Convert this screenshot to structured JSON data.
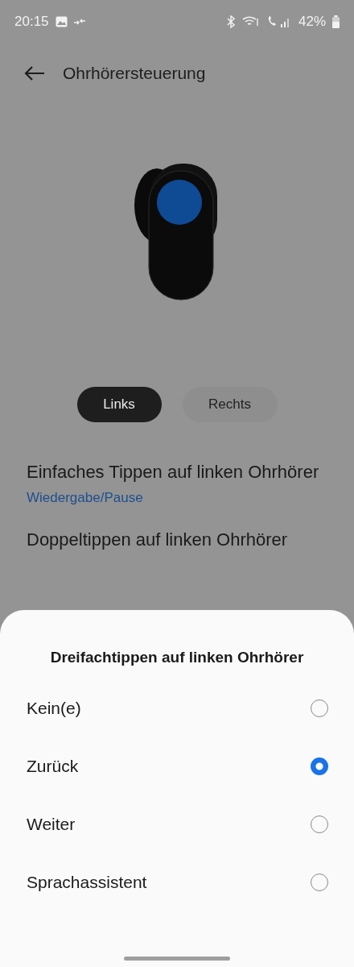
{
  "status_bar": {
    "time": "20:15",
    "battery": "42%"
  },
  "header": {
    "title": "Ohrhörersteuerung"
  },
  "tabs": [
    {
      "label": "Links",
      "selected": true
    },
    {
      "label": "Rechts",
      "selected": false
    }
  ],
  "settings": [
    {
      "title": "Einfaches Tippen auf linken Ohrhörer",
      "value": "Wiedergabe/Pause"
    },
    {
      "title": "Doppeltippen auf linken Ohrhörer"
    }
  ],
  "sheet": {
    "title": "Dreifachtippen auf linken Ohrhörer",
    "options": [
      {
        "label": "Kein(e)",
        "selected": false
      },
      {
        "label": "Zurück",
        "selected": true
      },
      {
        "label": "Weiter",
        "selected": false
      },
      {
        "label": "Sprachassistent",
        "selected": false
      }
    ]
  }
}
